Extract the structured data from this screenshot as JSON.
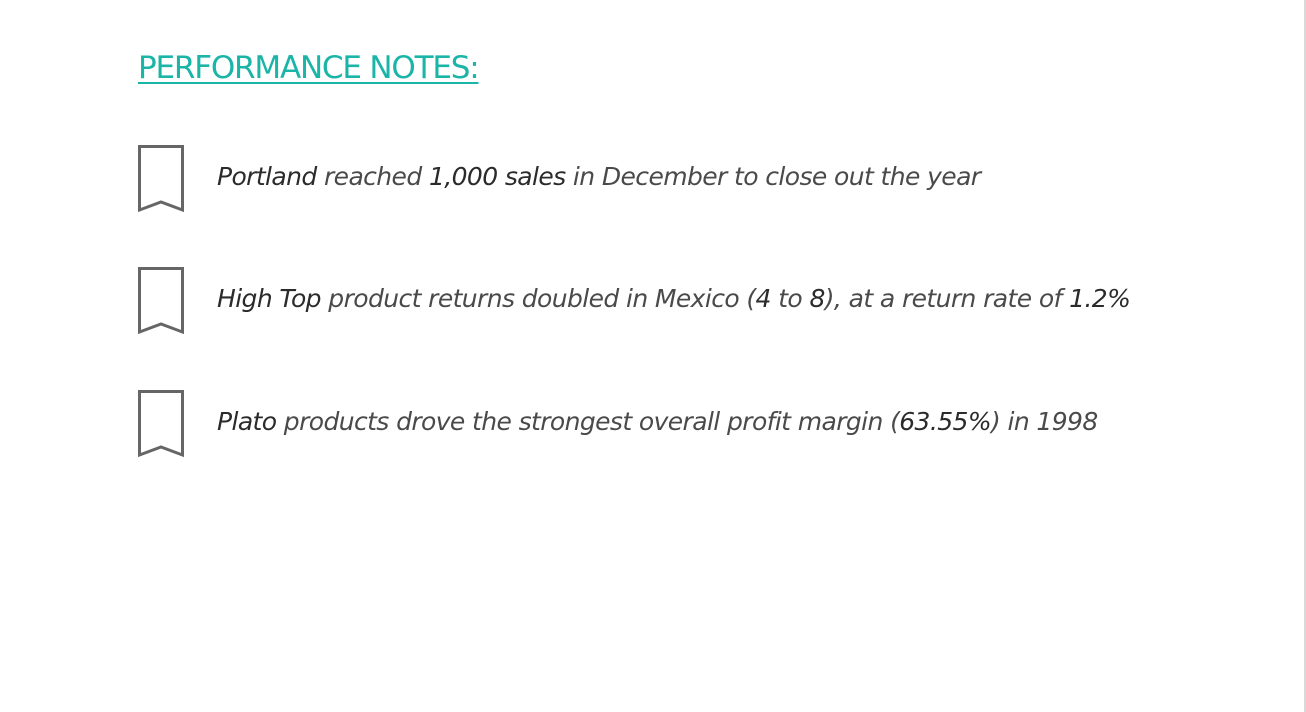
{
  "colors": {
    "accent": "#1bb5a8",
    "text": "#4a4a4a",
    "highlight": "#2b2b2b",
    "icon": "#666666"
  },
  "title": "PERFORMANCE NOTES:",
  "notes": [
    {
      "icon": "bookmark-icon",
      "segments": [
        {
          "text": "Portland",
          "highlight": true
        },
        {
          "text": " reached ",
          "highlight": false
        },
        {
          "text": "1,000 sales",
          "highlight": true
        },
        {
          "text": " in December to close out the year",
          "highlight": false
        }
      ]
    },
    {
      "icon": "bookmark-icon",
      "segments": [
        {
          "text": "High Top",
          "highlight": true
        },
        {
          "text": " product returns doubled in Mexico (",
          "highlight": false
        },
        {
          "text": "4",
          "highlight": true
        },
        {
          "text": " to ",
          "highlight": false
        },
        {
          "text": "8",
          "highlight": true
        },
        {
          "text": "), at a return rate of ",
          "highlight": false
        },
        {
          "text": "1.2%",
          "highlight": true
        }
      ]
    },
    {
      "icon": "bookmark-icon",
      "segments": [
        {
          "text": "Plato",
          "highlight": true
        },
        {
          "text": " products drove the strongest overall profit margin (",
          "highlight": false
        },
        {
          "text": "63.55%",
          "highlight": true
        },
        {
          "text": ") in 1998",
          "highlight": false
        }
      ]
    }
  ]
}
